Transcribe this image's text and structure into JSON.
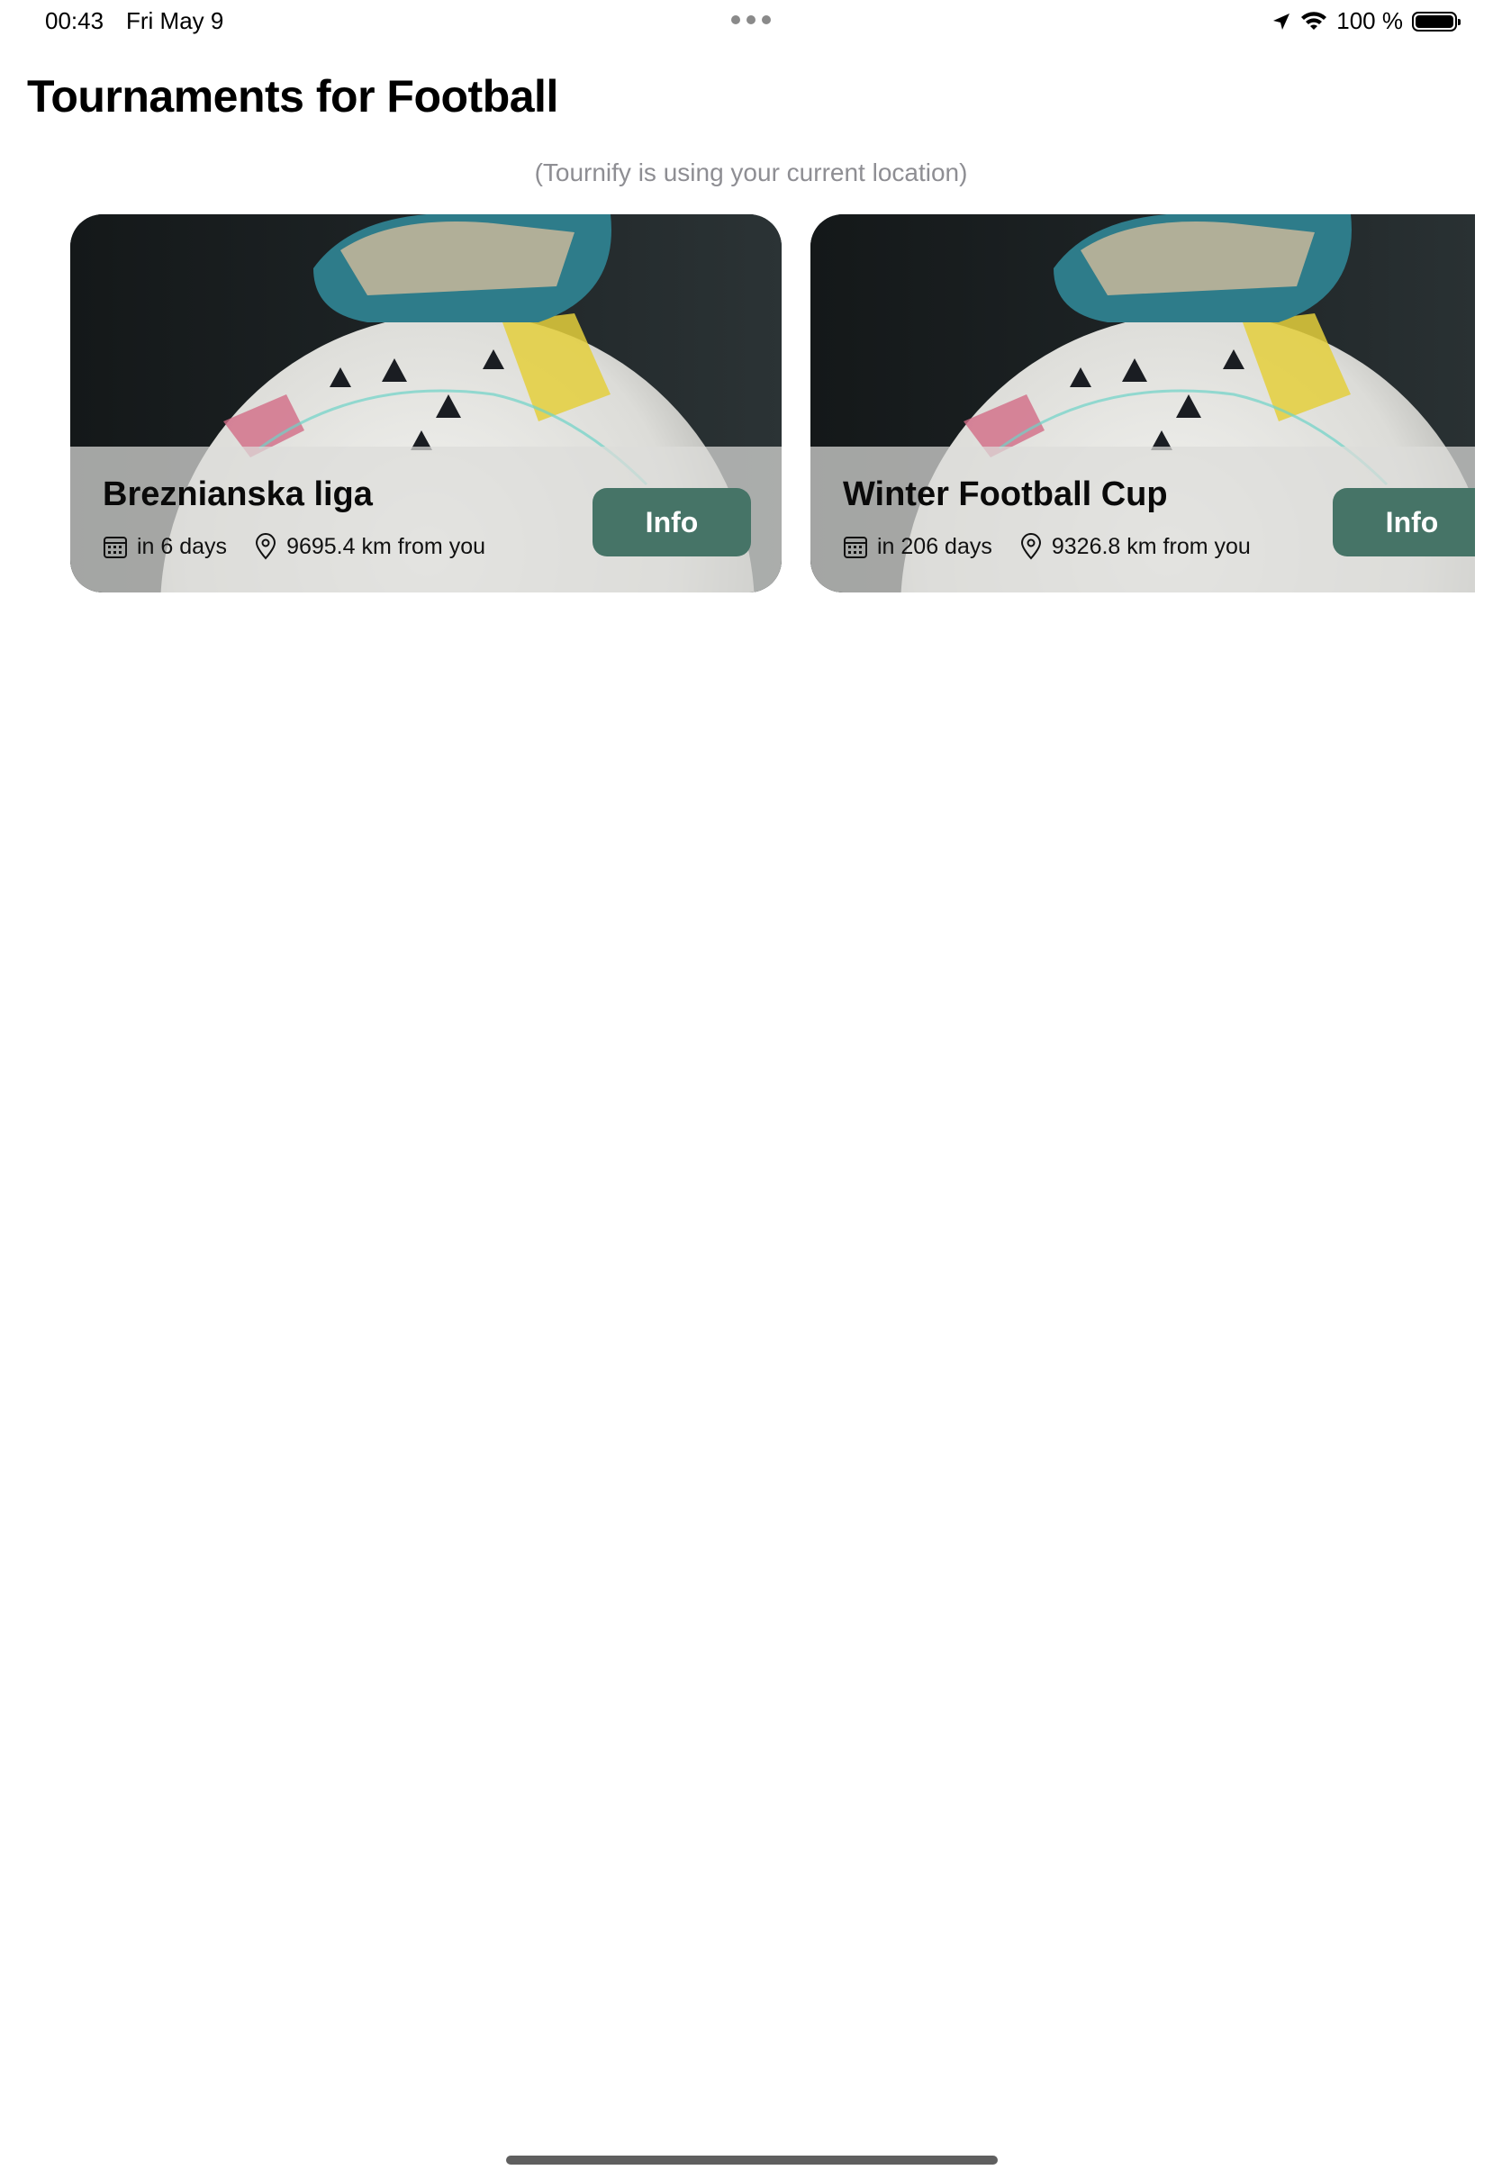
{
  "status_bar": {
    "time": "00:43",
    "date": "Fri May 9",
    "battery": "100 %"
  },
  "header": {
    "title_prefix": "Tournaments for ",
    "sport": "Football",
    "location_note": "(Tournify is using your current location)"
  },
  "tournaments": [
    {
      "name": "Breznianska liga",
      "starts": "in 6 days",
      "distance": "9695.4 km from you",
      "button_label": "Info"
    },
    {
      "name": "Winter Football Cup",
      "starts": "in 206 days",
      "distance": "9326.8 km from you",
      "button_label": "Info"
    }
  ],
  "colors": {
    "accent": "#467467",
    "subtitle_gray": "#8e8e93"
  }
}
